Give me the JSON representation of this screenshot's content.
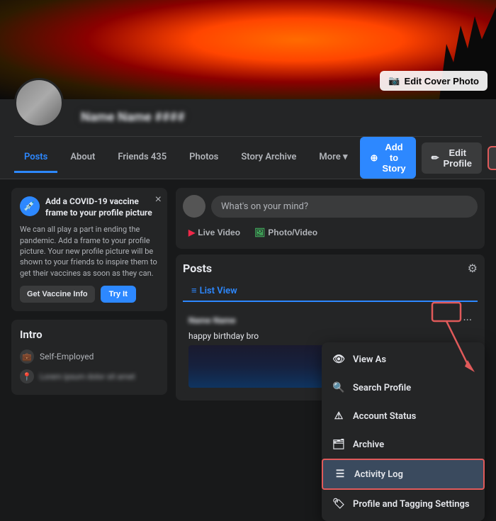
{
  "cover": {
    "edit_btn": "Edit Cover Photo",
    "camera_icon": "📷"
  },
  "profile": {
    "name": "Name Name ####",
    "avatar_alt": "profile-picture"
  },
  "nav": {
    "tabs": [
      {
        "id": "posts",
        "label": "Posts",
        "active": true
      },
      {
        "id": "about",
        "label": "About",
        "active": false
      },
      {
        "id": "friends",
        "label": "Friends 435",
        "active": false
      },
      {
        "id": "photos",
        "label": "Photos",
        "active": false
      },
      {
        "id": "story-archive",
        "label": "Story Archive",
        "active": false
      },
      {
        "id": "more",
        "label": "More ▾",
        "active": false
      }
    ],
    "add_story_label": "Add to Story",
    "edit_profile_label": "Edit Profile",
    "more_dots_label": "···"
  },
  "vaccine_card": {
    "title": "Add a COVID-19 vaccine frame to your profile picture",
    "body": "We can all play a part in ending the pandemic. Add a frame to your profile picture. Your new profile picture will be shown to your friends to inspire them to get their vaccines as soon as they can.",
    "btn_info": "Get Vaccine Info",
    "btn_try": "Try It",
    "close": "×"
  },
  "intro": {
    "title": "Intro",
    "employed_label": "Self-Employed",
    "blurred_text": "Lorem ipsum dolor sit amet"
  },
  "post_box": {
    "placeholder": "What's on your mind?",
    "live_video": "Live Video",
    "photo_video": "Photo/Video"
  },
  "posts_section": {
    "title": "Posts",
    "filter_icon": "⚙",
    "list_view": "List View",
    "post_text": "happy birthday bro",
    "post_dots": "···"
  },
  "dropdown": {
    "items": [
      {
        "id": "view-as",
        "icon": "👁",
        "label": "View As"
      },
      {
        "id": "search-profile",
        "icon": "🔍",
        "label": "Search Profile"
      },
      {
        "id": "account-status",
        "icon": "⚠",
        "label": "Account Status"
      },
      {
        "id": "archive",
        "icon": "🗂",
        "label": "Archive"
      },
      {
        "id": "activity-log",
        "icon": "☰",
        "label": "Activity Log",
        "highlighted": true
      },
      {
        "id": "profile-tagging",
        "icon": "🏷",
        "label": "Profile and Tagging Settings"
      }
    ]
  },
  "colors": {
    "accent_blue": "#2d88ff",
    "dark_bg": "#18191a",
    "card_bg": "#242526",
    "border_color": "#3a3b3c",
    "red_highlight": "#e05a5a",
    "text_primary": "#e4e6eb",
    "text_secondary": "#b0b3b8"
  }
}
